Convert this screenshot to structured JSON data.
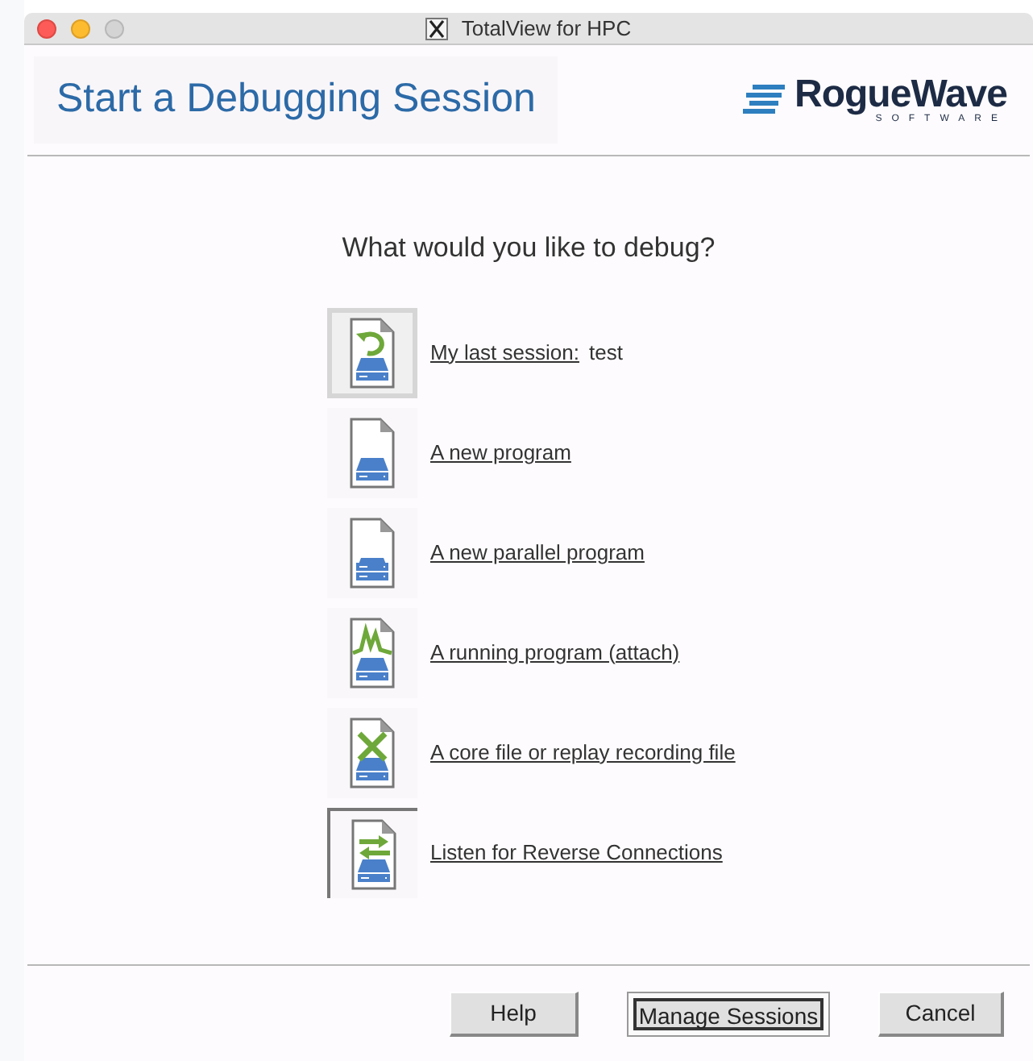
{
  "window": {
    "title": "TotalView for HPC"
  },
  "header": {
    "title": "Start a Debugging Session",
    "logo": {
      "name": "RogueWave",
      "tagline": "SOFTWARE"
    }
  },
  "prompt": "What would you like to debug?",
  "options": [
    {
      "kind": "restore",
      "label": "My last session:",
      "value": "test",
      "selected": true,
      "focused": false
    },
    {
      "kind": "program",
      "label": "A new program",
      "selected": false,
      "focused": false
    },
    {
      "kind": "parallel",
      "label": "A new parallel program",
      "selected": false,
      "focused": false
    },
    {
      "kind": "attach",
      "label": "A running program (attach)",
      "selected": false,
      "focused": false
    },
    {
      "kind": "core",
      "label": "A core file or replay recording file",
      "selected": false,
      "focused": false
    },
    {
      "kind": "listen",
      "label": "Listen for Reverse Connections",
      "selected": false,
      "focused": true
    }
  ],
  "buttons": [
    {
      "label": "Help",
      "default": false
    },
    {
      "label": "Manage Sessions",
      "default": true
    },
    {
      "label": "Cancel",
      "default": false
    }
  ]
}
